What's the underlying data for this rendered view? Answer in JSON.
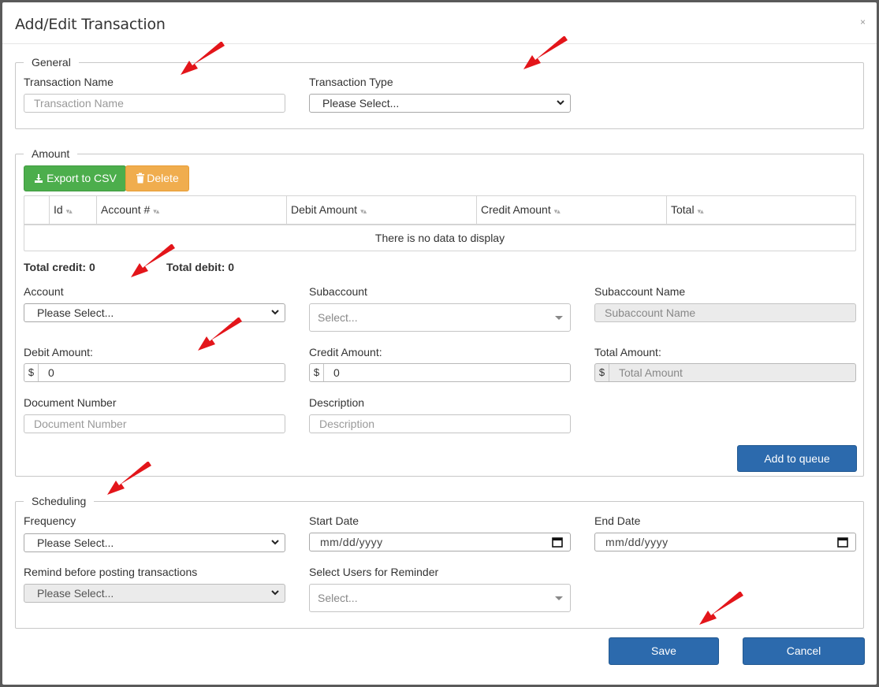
{
  "modal": {
    "title": "Add/Edit Transaction",
    "close": "×"
  },
  "general": {
    "legend": "General",
    "name_label": "Transaction Name",
    "name_placeholder": "Transaction Name",
    "type_label": "Transaction Type",
    "type_value": "Please Select..."
  },
  "amount": {
    "legend": "Amount",
    "export_label": "Export to CSV",
    "delete_label": "Delete",
    "columns": [
      "Id",
      "Account #",
      "Debit Amount",
      "Credit Amount",
      "Total"
    ],
    "empty_text": "There is no data to display",
    "total_credit": "Total credit: 0",
    "total_debit": "Total debit: 0",
    "account_label": "Account",
    "account_value": "Please Select...",
    "subaccount_label": "Subaccount",
    "subaccount_value": "Select...",
    "subaccount_name_label": "Subaccount Name",
    "subaccount_name_placeholder": "Subaccount Name",
    "debit_label": "Debit Amount:",
    "debit_value": "0",
    "credit_label": "Credit Amount:",
    "credit_value": "0",
    "total_label": "Total Amount:",
    "total_placeholder": "Total Amount",
    "currency": "$",
    "docnum_label": "Document Number",
    "docnum_placeholder": "Document Number",
    "desc_label": "Description",
    "desc_placeholder": "Description",
    "add_queue_label": "Add to queue"
  },
  "scheduling": {
    "legend": "Scheduling",
    "frequency_label": "Frequency",
    "frequency_value": "Please Select...",
    "start_label": "Start Date",
    "start_value": "mm/dd/yyyy",
    "end_label": "End Date",
    "end_value": "mm/dd/yyyy",
    "remind_label": "Remind before posting transactions",
    "remind_value": "Please Select...",
    "users_label": "Select Users for Reminder",
    "users_value": "Select..."
  },
  "footer": {
    "save_label": "Save",
    "cancel_label": "Cancel"
  },
  "colors": {
    "primary": "#2c6aad",
    "success": "#4cae4c",
    "warning": "#f0ad4e",
    "annotation_arrow": "#e3151a"
  }
}
